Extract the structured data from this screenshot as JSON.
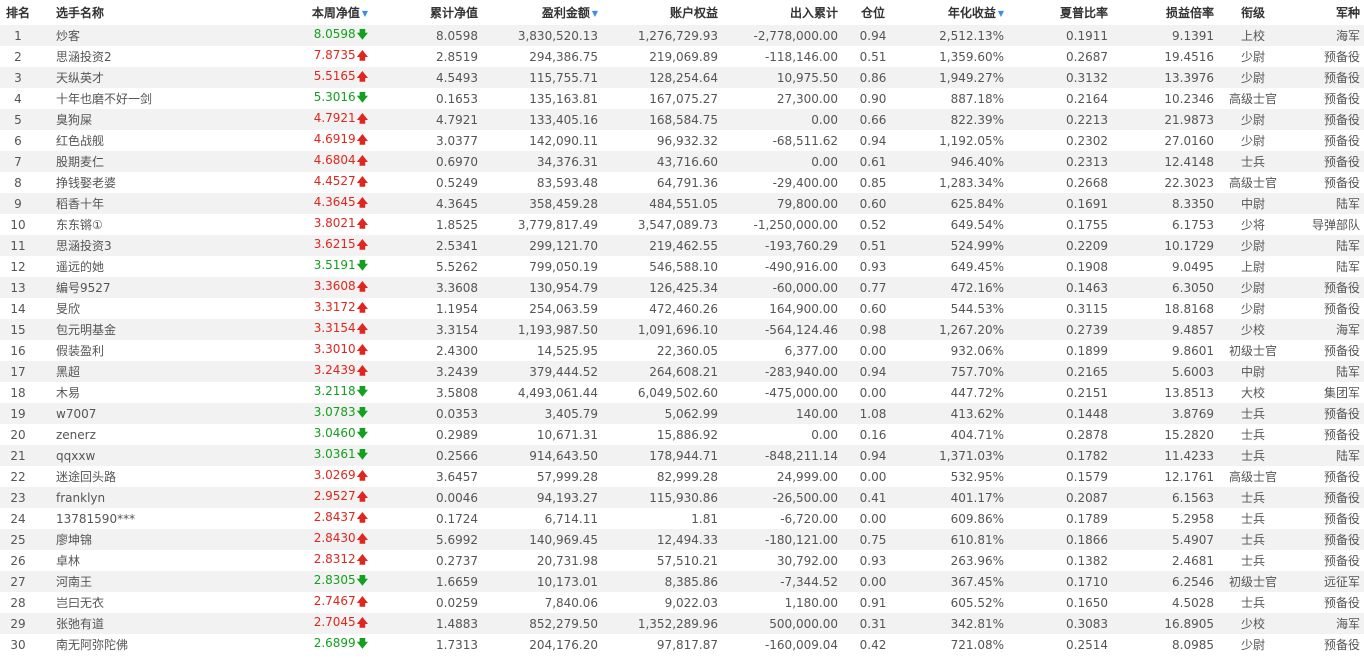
{
  "headers": {
    "rank": "排名",
    "name": "选手名称",
    "week_nav": "本周净值",
    "cum_nav": "累计净值",
    "profit": "盈利金额",
    "equity": "账户权益",
    "inout": "出入累计",
    "position": "仓位",
    "annual": "年化收益",
    "sharpe": "夏普比率",
    "pl_ratio": "损益倍率",
    "rank_title": "衔级",
    "army": "军种"
  },
  "icons": {
    "sort": "▼",
    "up": "🡅",
    "down": "🡇"
  },
  "colors": {
    "up": "#e0261e",
    "down": "#13a01e",
    "sort": "#3a8ee6"
  },
  "rows": [
    {
      "rank": "1",
      "name": "炒客",
      "week_nav": "8.0598",
      "dir": "down",
      "cum_nav": "8.0598",
      "profit": "3,830,520.13",
      "equity": "1,276,729.93",
      "inout": "-2,778,000.00",
      "position": "0.94",
      "annual": "2,512.13%",
      "sharpe": "0.1911",
      "pl_ratio": "9.1391",
      "rank_title": "上校",
      "army": "海军"
    },
    {
      "rank": "2",
      "name": "思涵投资2",
      "week_nav": "7.8735",
      "dir": "up",
      "cum_nav": "2.8519",
      "profit": "294,386.75",
      "equity": "219,069.89",
      "inout": "-118,146.00",
      "position": "0.51",
      "annual": "1,359.60%",
      "sharpe": "0.2687",
      "pl_ratio": "19.4516",
      "rank_title": "少尉",
      "army": "预备役"
    },
    {
      "rank": "3",
      "name": "天纵英才",
      "week_nav": "5.5165",
      "dir": "up",
      "cum_nav": "4.5493",
      "profit": "115,755.71",
      "equity": "128,254.64",
      "inout": "10,975.50",
      "position": "0.86",
      "annual": "1,949.27%",
      "sharpe": "0.3132",
      "pl_ratio": "13.3976",
      "rank_title": "少尉",
      "army": "预备役"
    },
    {
      "rank": "4",
      "name": "十年也磨不好一剑",
      "week_nav": "5.3016",
      "dir": "down",
      "cum_nav": "0.1653",
      "profit": "135,163.81",
      "equity": "167,075.27",
      "inout": "27,300.00",
      "position": "0.90",
      "annual": "887.18%",
      "sharpe": "0.2164",
      "pl_ratio": "10.2346",
      "rank_title": "高级士官",
      "army": "预备役"
    },
    {
      "rank": "5",
      "name": "臭狗屎",
      "week_nav": "4.7921",
      "dir": "up",
      "cum_nav": "4.7921",
      "profit": "133,405.16",
      "equity": "168,584.75",
      "inout": "0.00",
      "position": "0.66",
      "annual": "822.39%",
      "sharpe": "0.2213",
      "pl_ratio": "21.9873",
      "rank_title": "少尉",
      "army": "预备役"
    },
    {
      "rank": "6",
      "name": "红色战舰",
      "week_nav": "4.6919",
      "dir": "up",
      "cum_nav": "3.0377",
      "profit": "142,090.11",
      "equity": "96,932.32",
      "inout": "-68,511.62",
      "position": "0.94",
      "annual": "1,192.05%",
      "sharpe": "0.2302",
      "pl_ratio": "27.0160",
      "rank_title": "少尉",
      "army": "预备役"
    },
    {
      "rank": "7",
      "name": "股期麦仁",
      "week_nav": "4.6804",
      "dir": "up",
      "cum_nav": "0.6970",
      "profit": "34,376.31",
      "equity": "43,716.60",
      "inout": "0.00",
      "position": "0.61",
      "annual": "946.40%",
      "sharpe": "0.2313",
      "pl_ratio": "12.4148",
      "rank_title": "士兵",
      "army": "预备役"
    },
    {
      "rank": "8",
      "name": "挣钱娶老婆",
      "week_nav": "4.4527",
      "dir": "up",
      "cum_nav": "0.5249",
      "profit": "83,593.48",
      "equity": "64,791.36",
      "inout": "-29,400.00",
      "position": "0.85",
      "annual": "1,283.34%",
      "sharpe": "0.2668",
      "pl_ratio": "22.3023",
      "rank_title": "高级士官",
      "army": "预备役"
    },
    {
      "rank": "9",
      "name": "稻香十年",
      "week_nav": "4.3645",
      "dir": "up",
      "cum_nav": "4.3645",
      "profit": "358,459.28",
      "equity": "484,551.05",
      "inout": "79,800.00",
      "position": "0.60",
      "annual": "625.84%",
      "sharpe": "0.1691",
      "pl_ratio": "8.3350",
      "rank_title": "中尉",
      "army": "陆军"
    },
    {
      "rank": "10",
      "name": "东东锵①",
      "week_nav": "3.8021",
      "dir": "up",
      "cum_nav": "1.8525",
      "profit": "3,779,817.49",
      "equity": "3,547,089.73",
      "inout": "-1,250,000.00",
      "position": "0.52",
      "annual": "649.54%",
      "sharpe": "0.1755",
      "pl_ratio": "6.1753",
      "rank_title": "少将",
      "army": "导弹部队"
    },
    {
      "rank": "11",
      "name": "思涵投资3",
      "week_nav": "3.6215",
      "dir": "up",
      "cum_nav": "2.5341",
      "profit": "299,121.70",
      "equity": "219,462.55",
      "inout": "-193,760.29",
      "position": "0.51",
      "annual": "524.99%",
      "sharpe": "0.2209",
      "pl_ratio": "10.1729",
      "rank_title": "少尉",
      "army": "陆军"
    },
    {
      "rank": "12",
      "name": "遥远的她",
      "week_nav": "3.5191",
      "dir": "down",
      "cum_nav": "5.5262",
      "profit": "799,050.19",
      "equity": "546,588.10",
      "inout": "-490,916.00",
      "position": "0.93",
      "annual": "649.45%",
      "sharpe": "0.1908",
      "pl_ratio": "9.0495",
      "rank_title": "上尉",
      "army": "陆军"
    },
    {
      "rank": "13",
      "name": "编号9527",
      "week_nav": "3.3608",
      "dir": "up",
      "cum_nav": "3.3608",
      "profit": "130,954.79",
      "equity": "126,425.34",
      "inout": "-60,000.00",
      "position": "0.77",
      "annual": "472.16%",
      "sharpe": "0.1463",
      "pl_ratio": "6.3050",
      "rank_title": "少尉",
      "army": "预备役"
    },
    {
      "rank": "14",
      "name": "旻欣",
      "week_nav": "3.3172",
      "dir": "up",
      "cum_nav": "1.1954",
      "profit": "254,063.59",
      "equity": "472,460.26",
      "inout": "164,900.00",
      "position": "0.60",
      "annual": "544.53%",
      "sharpe": "0.3115",
      "pl_ratio": "18.8168",
      "rank_title": "少尉",
      "army": "预备役"
    },
    {
      "rank": "15",
      "name": "包元明基金",
      "week_nav": "3.3154",
      "dir": "up",
      "cum_nav": "3.3154",
      "profit": "1,193,987.50",
      "equity": "1,091,696.10",
      "inout": "-564,124.46",
      "position": "0.98",
      "annual": "1,267.20%",
      "sharpe": "0.2739",
      "pl_ratio": "9.4857",
      "rank_title": "少校",
      "army": "海军"
    },
    {
      "rank": "16",
      "name": "假装盈利",
      "week_nav": "3.3010",
      "dir": "up",
      "cum_nav": "2.4300",
      "profit": "14,525.95",
      "equity": "22,360.05",
      "inout": "6,377.00",
      "position": "0.00",
      "annual": "932.06%",
      "sharpe": "0.1899",
      "pl_ratio": "9.8601",
      "rank_title": "初级士官",
      "army": "预备役"
    },
    {
      "rank": "17",
      "name": "黑超",
      "week_nav": "3.2439",
      "dir": "up",
      "cum_nav": "3.2439",
      "profit": "379,444.52",
      "equity": "264,608.21",
      "inout": "-283,940.00",
      "position": "0.94",
      "annual": "757.70%",
      "sharpe": "0.2165",
      "pl_ratio": "5.6003",
      "rank_title": "中尉",
      "army": "陆军"
    },
    {
      "rank": "18",
      "name": "木易",
      "week_nav": "3.2118",
      "dir": "down",
      "cum_nav": "3.5808",
      "profit": "4,493,061.44",
      "equity": "6,049,502.60",
      "inout": "-475,000.00",
      "position": "0.00",
      "annual": "447.72%",
      "sharpe": "0.2151",
      "pl_ratio": "13.8513",
      "rank_title": "大校",
      "army": "集团军"
    },
    {
      "rank": "19",
      "name": "w7007",
      "week_nav": "3.0783",
      "dir": "down",
      "cum_nav": "0.0353",
      "profit": "3,405.79",
      "equity": "5,062.99",
      "inout": "140.00",
      "position": "1.08",
      "annual": "413.62%",
      "sharpe": "0.1448",
      "pl_ratio": "3.8769",
      "rank_title": "士兵",
      "army": "预备役"
    },
    {
      "rank": "20",
      "name": "zenerz",
      "week_nav": "3.0460",
      "dir": "down",
      "cum_nav": "0.2989",
      "profit": "10,671.31",
      "equity": "15,886.92",
      "inout": "0.00",
      "position": "0.16",
      "annual": "404.71%",
      "sharpe": "0.2878",
      "pl_ratio": "15.2820",
      "rank_title": "士兵",
      "army": "预备役"
    },
    {
      "rank": "21",
      "name": "qqxxw",
      "week_nav": "3.0361",
      "dir": "down",
      "cum_nav": "0.2566",
      "profit": "914,643.50",
      "equity": "178,944.71",
      "inout": "-848,211.14",
      "position": "0.94",
      "annual": "1,371.03%",
      "sharpe": "0.1782",
      "pl_ratio": "11.4233",
      "rank_title": "士兵",
      "army": "陆军"
    },
    {
      "rank": "22",
      "name": "迷途回头路",
      "week_nav": "3.0269",
      "dir": "up",
      "cum_nav": "3.6457",
      "profit": "57,999.28",
      "equity": "82,999.28",
      "inout": "24,999.00",
      "position": "0.00",
      "annual": "532.95%",
      "sharpe": "0.1579",
      "pl_ratio": "12.1761",
      "rank_title": "高级士官",
      "army": "预备役"
    },
    {
      "rank": "23",
      "name": "franklyn",
      "week_nav": "2.9527",
      "dir": "up",
      "cum_nav": "0.0046",
      "profit": "94,193.27",
      "equity": "115,930.86",
      "inout": "-26,500.00",
      "position": "0.41",
      "annual": "401.17%",
      "sharpe": "0.2087",
      "pl_ratio": "6.1563",
      "rank_title": "士兵",
      "army": "预备役"
    },
    {
      "rank": "24",
      "name": "13781590***",
      "week_nav": "2.8437",
      "dir": "up",
      "cum_nav": "0.1724",
      "profit": "6,714.11",
      "equity": "1.81",
      "inout": "-6,720.00",
      "position": "0.00",
      "annual": "609.86%",
      "sharpe": "0.1789",
      "pl_ratio": "5.2958",
      "rank_title": "士兵",
      "army": "预备役"
    },
    {
      "rank": "25",
      "name": "廖坤锦",
      "week_nav": "2.8430",
      "dir": "up",
      "cum_nav": "5.6992",
      "profit": "140,969.45",
      "equity": "12,494.33",
      "inout": "-180,121.00",
      "position": "0.75",
      "annual": "610.81%",
      "sharpe": "0.1866",
      "pl_ratio": "5.4907",
      "rank_title": "士兵",
      "army": "预备役"
    },
    {
      "rank": "26",
      "name": "卓林",
      "week_nav": "2.8312",
      "dir": "up",
      "cum_nav": "0.2737",
      "profit": "20,731.98",
      "equity": "57,510.21",
      "inout": "30,792.00",
      "position": "0.93",
      "annual": "263.96%",
      "sharpe": "0.1382",
      "pl_ratio": "2.4681",
      "rank_title": "士兵",
      "army": "预备役"
    },
    {
      "rank": "27",
      "name": "河南王",
      "week_nav": "2.8305",
      "dir": "down",
      "cum_nav": "1.6659",
      "profit": "10,173.01",
      "equity": "8,385.86",
      "inout": "-7,344.52",
      "position": "0.00",
      "annual": "367.45%",
      "sharpe": "0.1710",
      "pl_ratio": "6.2546",
      "rank_title": "初级士官",
      "army": "远征军"
    },
    {
      "rank": "28",
      "name": "岂曰无衣",
      "week_nav": "2.7467",
      "dir": "up",
      "cum_nav": "0.0259",
      "profit": "7,840.06",
      "equity": "9,022.03",
      "inout": "1,180.00",
      "position": "0.91",
      "annual": "605.52%",
      "sharpe": "0.1650",
      "pl_ratio": "4.5028",
      "rank_title": "士兵",
      "army": "预备役"
    },
    {
      "rank": "29",
      "name": "张弛有道",
      "week_nav": "2.7045",
      "dir": "up",
      "cum_nav": "1.4883",
      "profit": "852,279.50",
      "equity": "1,352,289.96",
      "inout": "500,000.00",
      "position": "0.31",
      "annual": "342.81%",
      "sharpe": "0.3083",
      "pl_ratio": "16.8905",
      "rank_title": "少校",
      "army": "海军"
    },
    {
      "rank": "30",
      "name": "南无阿弥陀佛",
      "week_nav": "2.6899",
      "dir": "down",
      "cum_nav": "1.7313",
      "profit": "204,176.20",
      "equity": "97,817.87",
      "inout": "-160,009.04",
      "position": "0.42",
      "annual": "721.08%",
      "sharpe": "0.2514",
      "pl_ratio": "8.0985",
      "rank_title": "少尉",
      "army": "预备役"
    }
  ]
}
